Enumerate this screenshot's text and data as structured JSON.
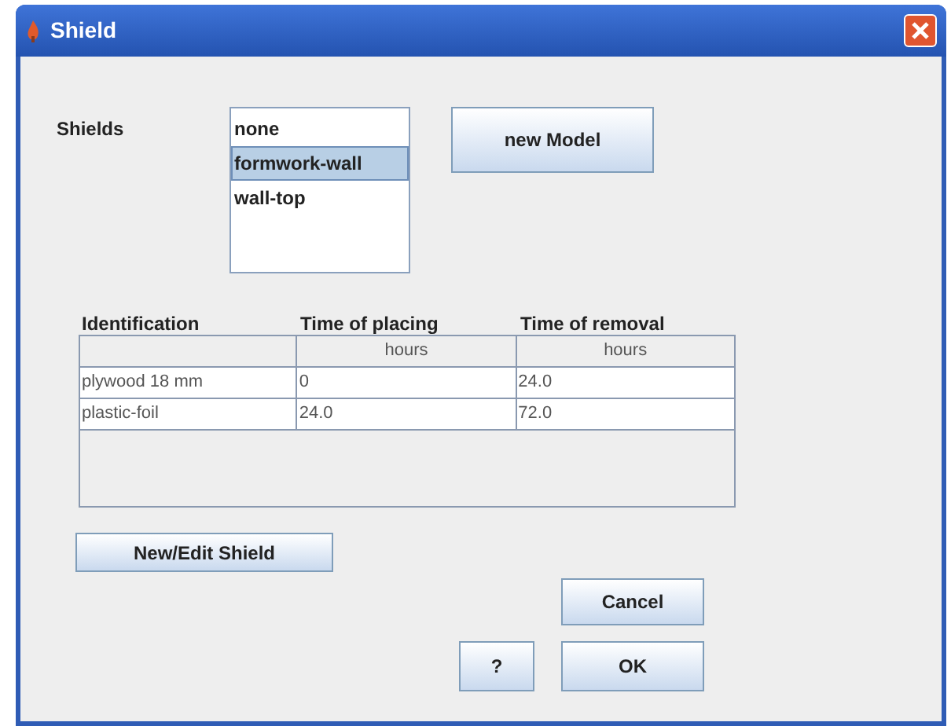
{
  "window": {
    "title": "Shield"
  },
  "shields": {
    "label": "Shields",
    "items": [
      {
        "label": "none",
        "selected": false
      },
      {
        "label": "formwork-wall",
        "selected": true
      },
      {
        "label": "wall-top",
        "selected": false
      }
    ]
  },
  "new_model_button": "new Model",
  "table": {
    "columns": [
      "Identification",
      "Time of placing",
      "Time of removal"
    ],
    "units": [
      "hours",
      "hours"
    ],
    "rows": [
      [
        "plywood 18 mm",
        "0",
        "24.0"
      ],
      [
        "plastic-foil",
        "24.0",
        "72.0"
      ]
    ]
  },
  "new_edit_button": "New/Edit Shield",
  "cancel_button": "Cancel",
  "help_button": "?",
  "ok_button": "OK"
}
